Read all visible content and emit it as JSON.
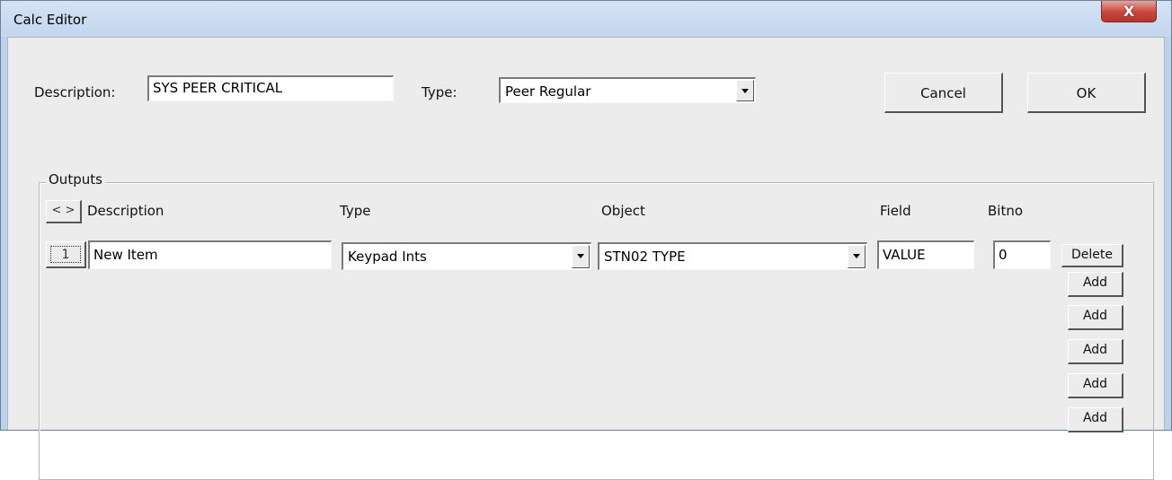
{
  "window": {
    "title": "Calc Editor",
    "close_glyph": "X"
  },
  "header": {
    "description_label": "Description:",
    "description_value": "SYS PEER CRITICAL",
    "type_label": "Type:",
    "type_value": "Peer Regular",
    "cancel_label": "Cancel",
    "ok_label": "OK"
  },
  "outputs": {
    "group_title": "Outputs",
    "scroll_glyph": "< >",
    "columns": {
      "description": "Description",
      "type": "Type",
      "object": "Object",
      "field": "Field",
      "bitno": "Bitno"
    },
    "rows": [
      {
        "number": "1",
        "description": "New Item",
        "type": "Keypad Ints",
        "object": "STN02 TYPE",
        "field": "VALUE",
        "bitno": "0"
      }
    ],
    "delete_label": "Delete",
    "add_labels": [
      "Add",
      "Add",
      "Add",
      "Add",
      "Add"
    ]
  }
}
